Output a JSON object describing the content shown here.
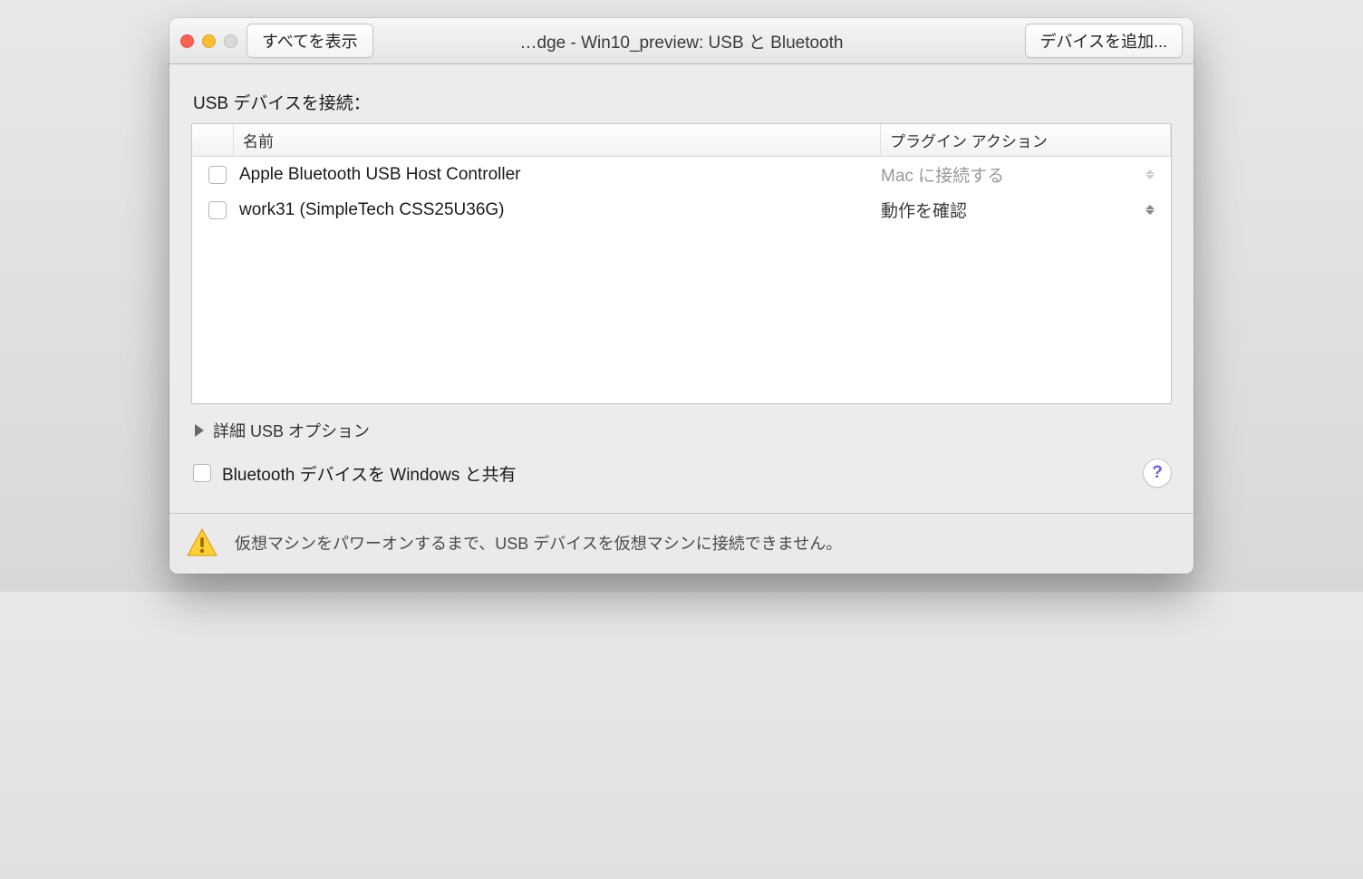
{
  "toolbar": {
    "show_all": "すべてを表示",
    "title": "…dge - Win10_preview: USB と Bluetooth",
    "add_device": "デバイスを追加..."
  },
  "section": {
    "label": "USB デバイスを接続："
  },
  "columns": {
    "name": "名前",
    "action": "プラグイン アクション"
  },
  "devices": [
    {
      "name": "Apple Bluetooth USB Host Controller",
      "action": "Mac に接続する",
      "disabled": true
    },
    {
      "name": "work31 (SimpleTech CSS25U36G)",
      "action": "動作を確認",
      "disabled": false
    }
  ],
  "disclosure": {
    "label": "詳細 USB オプション"
  },
  "share": {
    "label": "Bluetooth デバイスを Windows と共有"
  },
  "warning": {
    "text": "仮想マシンをパワーオンするまで、USB デバイスを仮想マシンに接続できません。"
  }
}
